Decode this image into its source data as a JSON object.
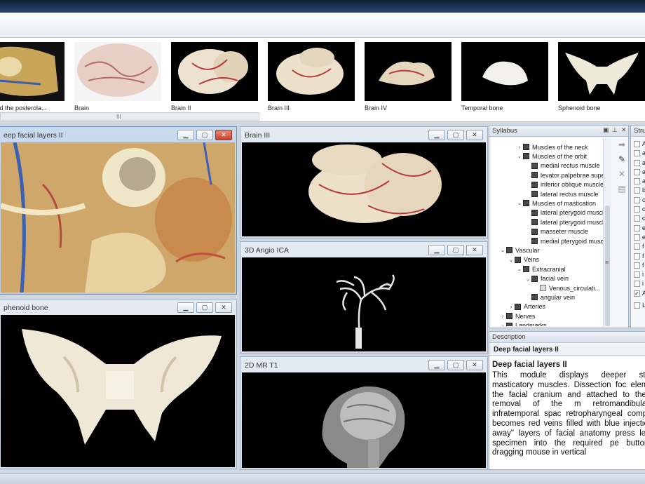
{
  "thumbnails": [
    {
      "caption": "ossa and the posterola..."
    },
    {
      "caption": "Brain"
    },
    {
      "caption": "Brain II"
    },
    {
      "caption": "Brain III"
    },
    {
      "caption": "Brain IV"
    },
    {
      "caption": "Temporal bone"
    },
    {
      "caption": "Sphenoid bone"
    }
  ],
  "scroll_grip": "III",
  "viewers": {
    "deep_facial": {
      "title": "eep facial layers II"
    },
    "sphenoid": {
      "title": "phenoid bone"
    },
    "brain3": {
      "title": "Brain III"
    },
    "angio": {
      "title": "3D Angio ICA"
    },
    "mr": {
      "title": "2D MR T1"
    }
  },
  "window_buttons": {
    "minimize": "▁",
    "maximize": "▢",
    "close": "✕"
  },
  "syllabus": {
    "title": "Syllabus",
    "header_icons": {
      "menu": "▣",
      "pin": "⊥",
      "close": "✕"
    },
    "items": [
      {
        "label": "Muscles of the neck",
        "arrow": "›",
        "level": 2,
        "kind": "folder"
      },
      {
        "label": "Muscles of the orbit",
        "arrow": "⌄",
        "level": 2,
        "kind": "folder"
      },
      {
        "label": "medial rectus muscle",
        "arrow": "",
        "level": 3,
        "kind": "folder"
      },
      {
        "label": "levator palpebrae supe...",
        "arrow": "",
        "level": 3,
        "kind": "folder"
      },
      {
        "label": "inferior oblique muscle",
        "arrow": "",
        "level": 3,
        "kind": "folder"
      },
      {
        "label": "lateral rectus muscle",
        "arrow": "",
        "level": 3,
        "kind": "folder"
      },
      {
        "label": "Muscles of mastication",
        "arrow": "⌄",
        "level": 2,
        "kind": "folder"
      },
      {
        "label": "lateral pterygoid muscl...",
        "arrow": "",
        "level": 3,
        "kind": "folder"
      },
      {
        "label": "lateral pterygoid muscl...",
        "arrow": "",
        "level": 3,
        "kind": "folder"
      },
      {
        "label": "masseter muscle",
        "arrow": "",
        "level": 3,
        "kind": "folder"
      },
      {
        "label": "medial pterygoid muscle",
        "arrow": "",
        "level": 3,
        "kind": "folder"
      },
      {
        "label": "Vascular",
        "arrow": "⌄",
        "level": 0,
        "kind": "folder"
      },
      {
        "label": "Veins",
        "arrow": "⌄",
        "level": 1,
        "kind": "folder"
      },
      {
        "label": "Extracranial",
        "arrow": "⌄",
        "level": 2,
        "kind": "folder"
      },
      {
        "label": "facial vein",
        "arrow": "⌄",
        "level": 3,
        "kind": "folder"
      },
      {
        "label": "Venous_circulati...",
        "arrow": "",
        "level": 4,
        "kind": "image"
      },
      {
        "label": "angular vein",
        "arrow": "",
        "level": 3,
        "kind": "folder"
      },
      {
        "label": "Arteries",
        "arrow": "›",
        "level": 1,
        "kind": "folder"
      },
      {
        "label": "Nerves",
        "arrow": "›",
        "level": 0,
        "kind": "folder"
      },
      {
        "label": "Landmarks",
        "arrow": "›",
        "level": 0,
        "kind": "folder"
      }
    ],
    "scroll_marker": "≡"
  },
  "tools": [
    {
      "icon": "➡",
      "name": "forward-icon",
      "active": false
    },
    {
      "icon": "✎",
      "name": "pen-icon",
      "active": true
    },
    {
      "icon": "✕",
      "name": "erase-icon",
      "active": false
    },
    {
      "icon": "▤",
      "name": "notes-icon",
      "active": false
    }
  ],
  "structures": {
    "title": "Stru",
    "items": [
      {
        "label": "A",
        "checked": false
      },
      {
        "label": "a",
        "checked": false
      },
      {
        "label": "a",
        "checked": false
      },
      {
        "label": "a",
        "checked": false
      },
      {
        "label": "a",
        "checked": false
      },
      {
        "label": "b",
        "checked": false
      },
      {
        "label": "c",
        "checked": false
      },
      {
        "label": "c",
        "checked": false
      },
      {
        "label": "c",
        "checked": false
      },
      {
        "label": "e",
        "checked": false
      },
      {
        "label": "e",
        "checked": false
      },
      {
        "label": "f",
        "checked": false
      },
      {
        "label": "f",
        "checked": false
      },
      {
        "label": "f",
        "checked": false
      },
      {
        "label": "i",
        "checked": false
      },
      {
        "label": "i",
        "checked": false
      },
      {
        "label": "A",
        "checked": true
      },
      {
        "label": "L",
        "checked": false
      }
    ]
  },
  "description": {
    "title": "Description",
    "label": "Deep facial layers II",
    "heading": "Deep facial layers II",
    "body": "This module displays deeper structures masticatory muscles. Dissection foc elements of the facial cranium and attached to them. The removal of the m retromandibular and infratemporal spac retropharyngeal compartment becomes red veins filled with blue injection mate away\" layers of facial anatomy press le tilt the specimen into the required pe button while dragging mouse in vertical"
  },
  "colors": {
    "accent": "#6f8fb5",
    "close": "#c8422c"
  }
}
